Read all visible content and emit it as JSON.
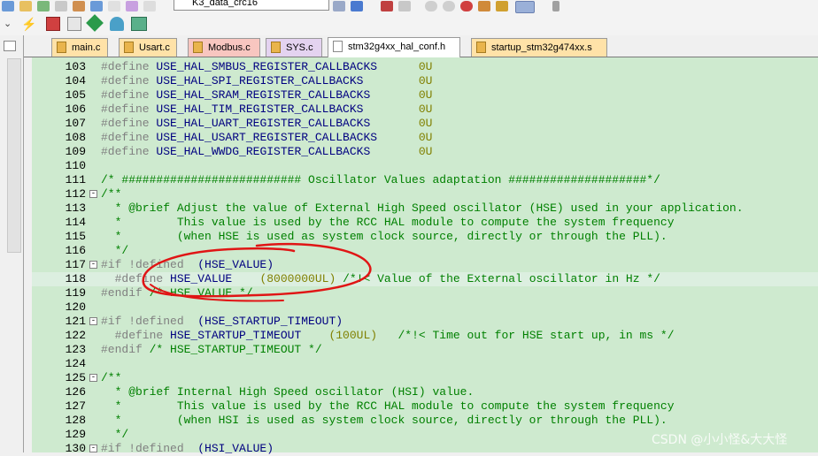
{
  "toolbar": {
    "target_name": "K3_data_crc16"
  },
  "tabs": [
    {
      "label": "main.c",
      "color": "#ffe2a8"
    },
    {
      "label": "Usart.c",
      "color": "#ffe2a8"
    },
    {
      "label": "Modbus.c",
      "color": "#f8c6c0"
    },
    {
      "label": "SYS.c",
      "color": "#e4d3f0"
    },
    {
      "label": "stm32g4xx_hal_conf.h",
      "color": "#ffffff"
    },
    {
      "label": "startup_stm32g474xx.s",
      "color": "#ffe2a8"
    }
  ],
  "active_tab": 4,
  "editor": {
    "background": "#ceeacf",
    "lines": [
      {
        "n": "103",
        "pp": "#define ",
        "id": "USE_HAL_SMBUS_REGISTER_CALLBACKS      ",
        "val": "0U"
      },
      {
        "n": "104",
        "pp": "#define ",
        "id": "USE_HAL_SPI_REGISTER_CALLBACKS        ",
        "val": "0U"
      },
      {
        "n": "105",
        "pp": "#define ",
        "id": "USE_HAL_SRAM_REGISTER_CALLBACKS       ",
        "val": "0U"
      },
      {
        "n": "106",
        "pp": "#define ",
        "id": "USE_HAL_TIM_REGISTER_CALLBACKS        ",
        "val": "0U"
      },
      {
        "n": "107",
        "pp": "#define ",
        "id": "USE_HAL_UART_REGISTER_CALLBACKS       ",
        "val": "0U"
      },
      {
        "n": "108",
        "pp": "#define ",
        "id": "USE_HAL_USART_REGISTER_CALLBACKS      ",
        "val": "0U"
      },
      {
        "n": "109",
        "pp": "#define ",
        "id": "USE_HAL_WWDG_REGISTER_CALLBACKS       ",
        "val": "0U"
      },
      {
        "n": "110"
      },
      {
        "n": "111",
        "cm": "/* ########################## Oscillator Values adaptation ####################*/"
      },
      {
        "n": "112",
        "cm": "/**",
        "fold": "-"
      },
      {
        "n": "113",
        "cm": "  * @brief Adjust the value of External High Speed oscillator (HSE) used in your application."
      },
      {
        "n": "114",
        "cm": "  *        This value is used by the RCC HAL module to compute the system frequency"
      },
      {
        "n": "115",
        "cm": "  *        (when HSE is used as system clock source, directly or through the PLL)."
      },
      {
        "n": "116",
        "cm": "  */"
      },
      {
        "n": "117",
        "pp": "#if !defined  ",
        "id": "(HSE_VALUE)",
        "fold": "-"
      },
      {
        "n": "118",
        "pp": "  #define ",
        "id": "HSE_VALUE    ",
        "val": "(8000000UL)",
        "cm2": " /*!< Value of the External oscillator in Hz */",
        "hl": true
      },
      {
        "n": "119",
        "pp": "#endif ",
        "cm2": "/* HSE_VALUE */"
      },
      {
        "n": "120"
      },
      {
        "n": "121",
        "pp": "#if !defined  ",
        "id": "(HSE_STARTUP_TIMEOUT)",
        "fold": "-"
      },
      {
        "n": "122",
        "pp": "  #define ",
        "id": "HSE_STARTUP_TIMEOUT    ",
        "val": "(100UL)",
        "cm2": "   /*!< Time out for HSE start up, in ms */"
      },
      {
        "n": "123",
        "pp": "#endif ",
        "cm2": "/* HSE_STARTUP_TIMEOUT */"
      },
      {
        "n": "124"
      },
      {
        "n": "125",
        "cm": "/**",
        "fold": "-"
      },
      {
        "n": "126",
        "cm": "  * @brief Internal High Speed oscillator (HSI) value."
      },
      {
        "n": "127",
        "cm": "  *        This value is used by the RCC HAL module to compute the system frequency"
      },
      {
        "n": "128",
        "cm": "  *        (when HSI is used as system clock source, directly or through the PLL)."
      },
      {
        "n": "129",
        "cm": "  */"
      },
      {
        "n": "130",
        "pp": "#if !defined  ",
        "id": "(HSI_VALUE)",
        "fold": "-"
      }
    ]
  },
  "watermark": "CSDN @小小怪&大大怪"
}
